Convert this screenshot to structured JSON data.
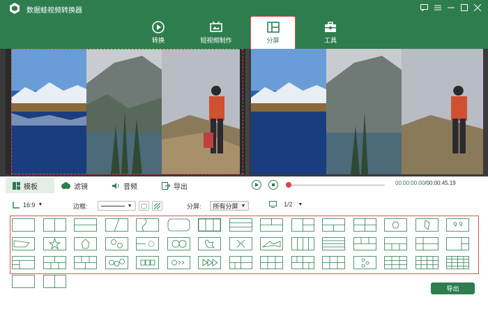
{
  "app": {
    "title": "数据蛙视频转换器"
  },
  "nav": [
    {
      "label": "转换",
      "icon": "convert-icon"
    },
    {
      "label": "短视频制作",
      "icon": "video-maker-icon"
    },
    {
      "label": "分屏",
      "icon": "split-screen-icon",
      "active": true
    },
    {
      "label": "工具",
      "icon": "toolbox-icon"
    }
  ],
  "tabs": [
    {
      "label": "模板",
      "icon": "template-icon",
      "active": true
    },
    {
      "label": "滤镜",
      "icon": "filter-icon"
    },
    {
      "label": "音频",
      "icon": "audio-icon"
    },
    {
      "label": "导出",
      "icon": "export-icon"
    }
  ],
  "player": {
    "time": "00:00:00.00",
    "duration": "/00:00:45.19",
    "progress": 0.0
  },
  "options": {
    "ratio": "16:9",
    "border_label": "边框:",
    "split_label": "分屏:",
    "split_value": "所有分屏",
    "page": "1/2"
  },
  "templates_count": 47,
  "buttons": {
    "export": "导出"
  },
  "colors": {
    "brand": "#2e7d4f",
    "highlight": "#d9534f"
  }
}
